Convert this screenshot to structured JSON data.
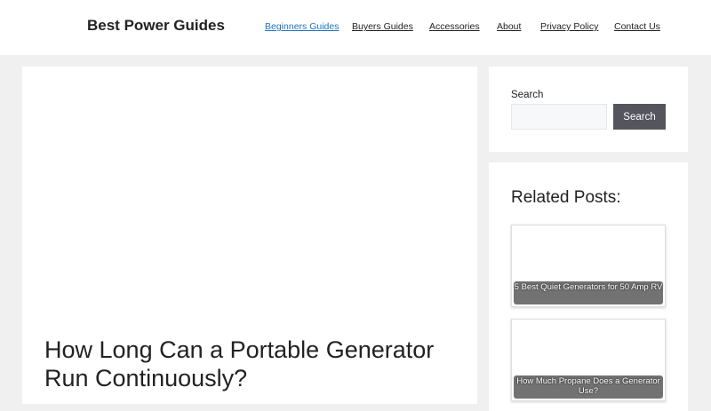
{
  "header": {
    "site_title": "Best Power Guides",
    "nav": [
      {
        "label": "Beginners Guides",
        "active": true
      },
      {
        "label": "Buyers Guides",
        "active": false
      },
      {
        "label": "Accessories",
        "active": false
      },
      {
        "label": "About",
        "active": false
      },
      {
        "label": "Privacy Policy",
        "active": false
      },
      {
        "label": "Contact Us",
        "active": false
      }
    ]
  },
  "main": {
    "post_title": "How Long Can a Portable Generator Run Continuously?"
  },
  "sidebar": {
    "search": {
      "label": "Search",
      "placeholder": "",
      "value": "",
      "button_label": "Search"
    },
    "related": {
      "heading": "Related Posts:",
      "posts": [
        {
          "title": "5 Best Quiet Generators for 50 Amp RV"
        },
        {
          "title": "How Much Propane Does a Generator Use?"
        }
      ]
    }
  },
  "colors": {
    "link_active": "#1e73be",
    "page_background": "#f0f0f0",
    "button_background": "#55555e"
  }
}
